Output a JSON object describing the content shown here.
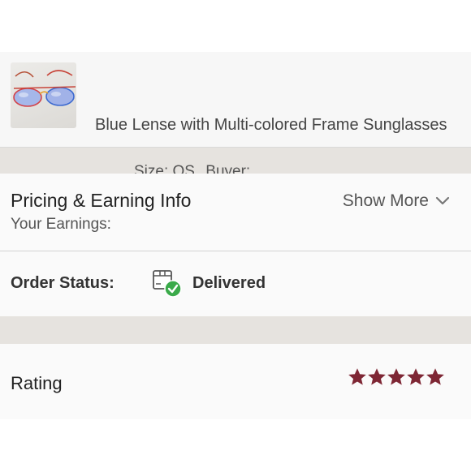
{
  "item": {
    "title": "Blue Lense with Multi-colored Frame Sunglasses",
    "size_text": "Size: OS",
    "buyer_text": "Buyer:"
  },
  "pricing": {
    "title": "Pricing & Earning Info",
    "earnings_label": "Your Earnings:",
    "show_more_label": "Show More",
    "show_more_icon": "chevron-down-icon"
  },
  "order": {
    "label": "Order Status:",
    "status": "Delivered",
    "status_icon": "package-delivered-icon",
    "status_check_color": "#3aaa4a"
  },
  "rating": {
    "label": "Rating",
    "stars": 5,
    "max_stars": 5,
    "star_color": "#7e2634"
  }
}
